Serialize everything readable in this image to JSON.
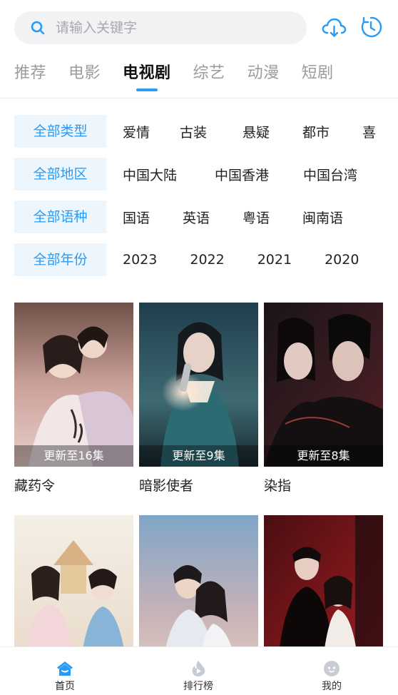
{
  "search": {
    "placeholder": "请输入关键字"
  },
  "tabs": [
    {
      "label": "推荐"
    },
    {
      "label": "电影"
    },
    {
      "label": "电视剧"
    },
    {
      "label": "综艺"
    },
    {
      "label": "动漫"
    },
    {
      "label": "短剧"
    }
  ],
  "active_tab": "电视剧",
  "filters": {
    "type": {
      "all": "全部类型",
      "options": [
        "爱情",
        "古装",
        "悬疑",
        "都市",
        "喜"
      ]
    },
    "region": {
      "all": "全部地区",
      "options": [
        "中国大陆",
        "中国香港",
        "中国台湾"
      ]
    },
    "language": {
      "all": "全部语种",
      "options": [
        "国语",
        "英语",
        "粤语",
        "闽南语"
      ]
    },
    "year": {
      "all": "全部年份",
      "options": [
        "2023",
        "2022",
        "2021",
        "2020"
      ]
    }
  },
  "cards": [
    {
      "title": "藏药令",
      "badge": "更新至16集"
    },
    {
      "title": "暗影使者",
      "badge": "更新至9集"
    },
    {
      "title": "染指",
      "badge": "更新至8集"
    },
    {
      "title": "",
      "badge": ""
    },
    {
      "title": "",
      "badge": ""
    },
    {
      "title": "",
      "badge": ""
    }
  ],
  "bottom_nav": [
    {
      "label": "首页",
      "icon": "home-icon"
    },
    {
      "label": "排行榜",
      "icon": "ranking-icon"
    },
    {
      "label": "我的",
      "icon": "profile-icon"
    }
  ],
  "colors": {
    "accent": "#2a9bf4",
    "filter_bg": "#edf5fd",
    "search_bg": "#f2f2f4"
  }
}
